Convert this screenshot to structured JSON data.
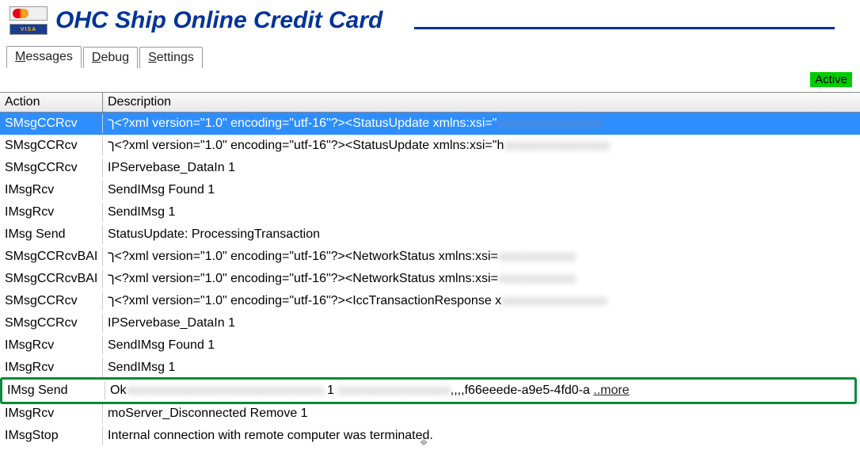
{
  "header": {
    "title": "OHC Ship Online Credit Card",
    "logo_visa": "VISA"
  },
  "tabs": [
    {
      "label": "Messages",
      "accelerator": "M",
      "active": true
    },
    {
      "label": "Debug",
      "accelerator": "D",
      "active": false
    },
    {
      "label": "Settings",
      "accelerator": "S",
      "active": false
    }
  ],
  "status": {
    "label": "Active"
  },
  "grid": {
    "columns": {
      "action": "Action",
      "description": "Description"
    },
    "rows": [
      {
        "action": "SMsgCCRcv",
        "desc": "ך<?xml version=\"1.0\" encoding=\"utf-16\"?><StatusUpdate xmlns:xsi=\"",
        "blur": "aaaaaaaaaaaaaaa",
        "selected": true
      },
      {
        "action": "SMsgCCRcv",
        "desc": "ך<?xml version=\"1.0\" encoding=\"utf-16\"?><StatusUpdate xmlns:xsi=\"h",
        "blur": "aaaaaaaaaaaaaaa"
      },
      {
        "action": "SMsgCCRcv",
        "desc": "IPServebase_DataIn 1"
      },
      {
        "action": "IMsgRcv",
        "desc": "SendIMsg Found 1"
      },
      {
        "action": "IMsgRcv",
        "desc": "SendIMsg 1"
      },
      {
        "action": "IMsg Send",
        "desc": "StatusUpdate: ProcessingTransaction"
      },
      {
        "action": "SMsgCCRcvBAI",
        "desc": "ך<?xml version=\"1.0\" encoding=\"utf-16\"?><NetworkStatus xmlns:xsi=",
        "blur": "aaaaaaaaaaa"
      },
      {
        "action": "SMsgCCRcvBAI",
        "desc": "ך<?xml version=\"1.0\" encoding=\"utf-16\"?><NetworkStatus xmlns:xsi=",
        "blur": "aaaaaaaaaaa"
      },
      {
        "action": "SMsgCCRcv",
        "desc": "ך<?xml version=\"1.0\" encoding=\"utf-16\"?><IccTransactionResponse x",
        "blur": "aaaaaaaaaaaaaaa"
      },
      {
        "action": "SMsgCCRcv",
        "desc": "IPServebase_DataIn 1"
      },
      {
        "action": "IMsgRcv",
        "desc": "SendIMsg Found 1"
      },
      {
        "action": "IMsgRcv",
        "desc": "SendIMsg 1"
      },
      {
        "action": "IMsg Send",
        "desc_prefix": "Ok",
        "blur1": "aaaaaaaaaaaaaaaaaaaaaaaaaaaa",
        "mid": " 1 ",
        "blur2": "aaaaaaaaaaaaaaaa",
        "suffix": ",,,,f66eeede-a9e5-4fd0-a ",
        "more": "..more",
        "highlighted": true
      },
      {
        "action": "IMsgRcv",
        "desc": "moServer_Disconnected Remove 1"
      },
      {
        "action": "IMsgStop",
        "desc": "Internal connection with remote computer was terminated."
      }
    ]
  }
}
